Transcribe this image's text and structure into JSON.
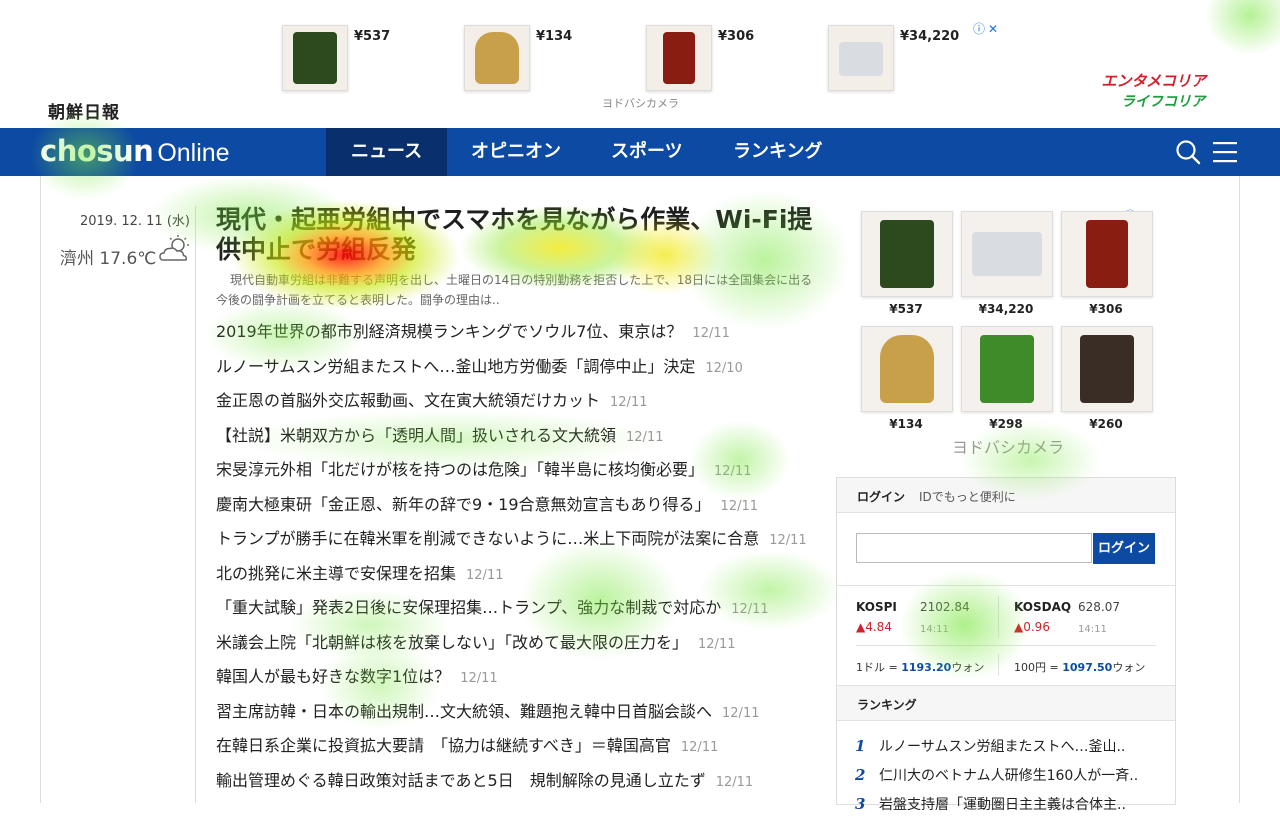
{
  "top_ad": {
    "items": [
      {
        "price": "¥537",
        "color": "#2c4a1e"
      },
      {
        "price": "¥134",
        "color": "#c9a04a"
      },
      {
        "price": "¥306",
        "color": "#8a1d12"
      },
      {
        "price": "¥34,220",
        "color": "#d9dde2"
      }
    ],
    "source": "ヨドバシカメラ",
    "brand_line1": "エンタメコリア",
    "brand_line2": "ライフコリア"
  },
  "site": {
    "logo_ja": "朝鮮日報",
    "logo_main": "chosun",
    "logo_sub": "Online"
  },
  "nav": {
    "items": [
      {
        "label": "ニュース",
        "active": true
      },
      {
        "label": "オピニオン"
      },
      {
        "label": "スポーツ"
      },
      {
        "label": "ランキング"
      }
    ]
  },
  "sidebar_left": {
    "date": "2019. 12. 11 (水)",
    "weather": "濟州 17.6℃"
  },
  "main": {
    "headline": "現代・起亜労組中でスマホを見ながら作業、Wi-Fi提供中止で労組反発",
    "summary": "現代自動車労組は非難する声明を出し、土曜日の14日の特別勤務を拒否した上で、18日には全国集会に出る今後の闘争計画を立てると表明した。闘争の理由は..",
    "articles": [
      {
        "title": "2019年世界の都市別経済規模ランキングでソウル7位、東京は？",
        "date": "12/11"
      },
      {
        "title": "ルノーサムスン労組またストへ…釜山地方労働委「調停中止」決定",
        "date": "12/10"
      },
      {
        "title": "金正恩の首脳外交広報動画、文在寅大統領だけカット",
        "date": "12/11"
      },
      {
        "title": "【社説】米朝双方から「透明人間」扱いされる文大統領",
        "date": "12/11"
      },
      {
        "title": "宋旻淳元外相「北だけが核を持つのは危険」「韓半島に核均衡必要」",
        "date": "12/11"
      },
      {
        "title": "慶南大極東研「金正恩、新年の辞で9・19合意無効宣言もあり得る」",
        "date": "12/11"
      },
      {
        "title": "トランプが勝手に在韓米軍を削減できないように…米上下両院が法案に合意",
        "date": "12/11"
      },
      {
        "title": "北の挑発に米主導で安保理を招集",
        "date": "12/11"
      },
      {
        "title": "「重大試験」発表2日後に安保理招集…トランプ、強力な制裁で対応か",
        "date": "12/11"
      },
      {
        "title": "米議会上院「北朝鮮は核を放棄しない」「改めて最大限の圧力を」",
        "date": "12/11"
      },
      {
        "title": "韓国人が最も好きな数字1位は？",
        "date": "12/11"
      },
      {
        "title": "習主席訪韓・日本の輸出規制…文大統領、難題抱え韓中日首脳会談へ",
        "date": "12/11"
      },
      {
        "title": "在韓日系企業に投資拡大要請　「協力は継続すべき」＝韓国高官",
        "date": "12/11"
      },
      {
        "title": "輸出管理めぐる韓日政策対話まであと5日　規制解除の見通し立たず",
        "date": "12/11"
      }
    ]
  },
  "side_ad": {
    "items": [
      {
        "price": "¥537",
        "color": "#2c4a1e"
      },
      {
        "price": "¥34,220",
        "color": "#d9dde2"
      },
      {
        "price": "¥306",
        "color": "#8a1d12"
      },
      {
        "price": "¥134",
        "color": "#c9a04a"
      },
      {
        "price": "¥298",
        "color": "#3f8b2a"
      },
      {
        "price": "¥260",
        "color": "#3a2d26"
      }
    ],
    "source": "ヨドバシカメラ"
  },
  "login": {
    "title": "ログイン",
    "subtitle": "IDでもっと便利に",
    "button": "ログイン",
    "input_value": ""
  },
  "market": {
    "kospi": {
      "name": "KOSPI",
      "value": "2102.84",
      "change": "▲4.84",
      "time": "14:11"
    },
    "kosdaq": {
      "name": "KOSDAQ",
      "value": "628.07",
      "change": "▲0.96",
      "time": "14:11"
    },
    "fx_usd": {
      "label": "1ドル =",
      "value": "1193.20",
      "unit": "ウォン"
    },
    "fx_jpy": {
      "label": "100円 =",
      "value": "1097.50",
      "unit": "ウォン"
    }
  },
  "ranking": {
    "title": "ランキング",
    "items": [
      {
        "num": "1",
        "title": "ルノーサムスン労組またストへ…釜山.."
      },
      {
        "num": "2",
        "title": "仁川大のベトナム人研修生160人が一斉.."
      },
      {
        "num": "3",
        "title": "岩盤支持層「運動圏日主主義は合体主.."
      }
    ]
  },
  "colors": {
    "brand_blue": "#0d4aa3",
    "nav_active": "#0a2f6d",
    "up_red": "#d0212b"
  }
}
